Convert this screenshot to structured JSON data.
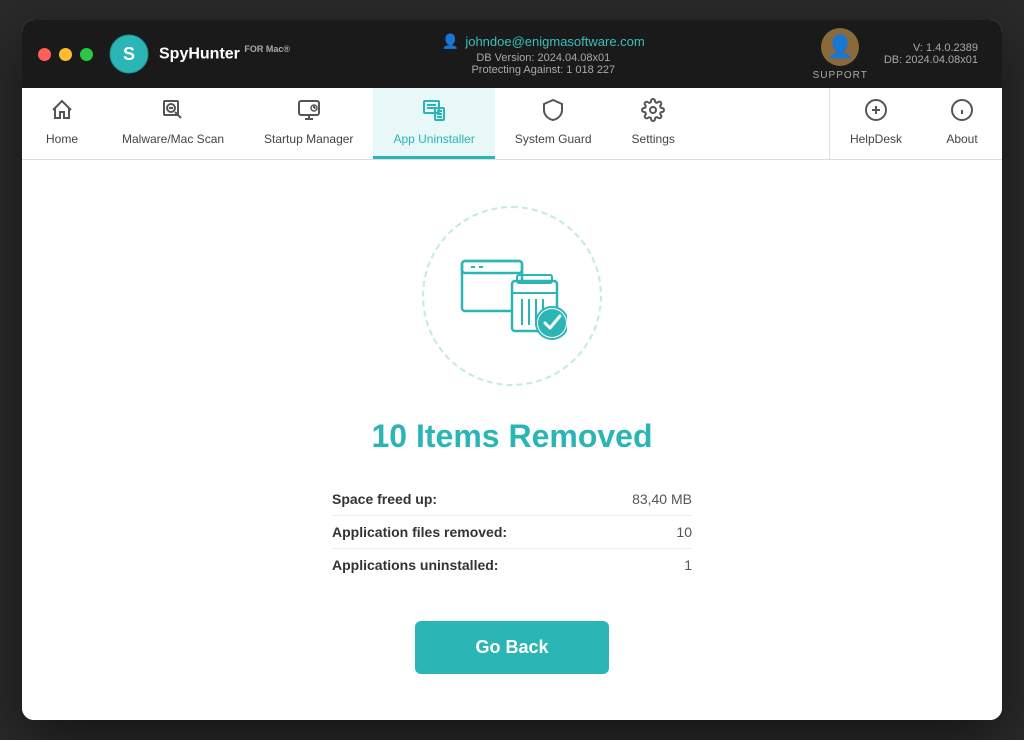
{
  "titlebar": {
    "logo_name": "SpyHunter",
    "logo_suffix": "FOR Mac®",
    "user_email": "johndoe@enigmasoftware.com",
    "db_version_label": "DB Version: 2024.04.08x01",
    "protecting_label": "Protecting Against: 1 018 227",
    "support_label": "SUPPORT",
    "version": "V: 1.4.0.2389",
    "db_short": "DB:  2024.04.08x01"
  },
  "navbar": {
    "items": [
      {
        "id": "home",
        "label": "Home",
        "icon": "🏠"
      },
      {
        "id": "malware-scan",
        "label": "Malware/Mac Scan",
        "icon": "🔍"
      },
      {
        "id": "startup-manager",
        "label": "Startup Manager",
        "icon": "⚙"
      },
      {
        "id": "app-uninstaller",
        "label": "App Uninstaller",
        "icon": "🗑"
      },
      {
        "id": "system-guard",
        "label": "System Guard",
        "icon": "🛡"
      },
      {
        "id": "settings",
        "label": "Settings",
        "icon": "⚙"
      }
    ],
    "right_items": [
      {
        "id": "helpdesk",
        "label": "HelpDesk",
        "icon": "➕"
      },
      {
        "id": "about",
        "label": "About",
        "icon": "ℹ"
      }
    ],
    "active": "app-uninstaller"
  },
  "main": {
    "result_title": "10 Items Removed",
    "stats": [
      {
        "label": "Space freed up:",
        "value": "83,40 MB"
      },
      {
        "label": "Application files removed:",
        "value": "10"
      },
      {
        "label": "Applications uninstalled:",
        "value": "1"
      }
    ],
    "go_back_label": "Go Back"
  }
}
